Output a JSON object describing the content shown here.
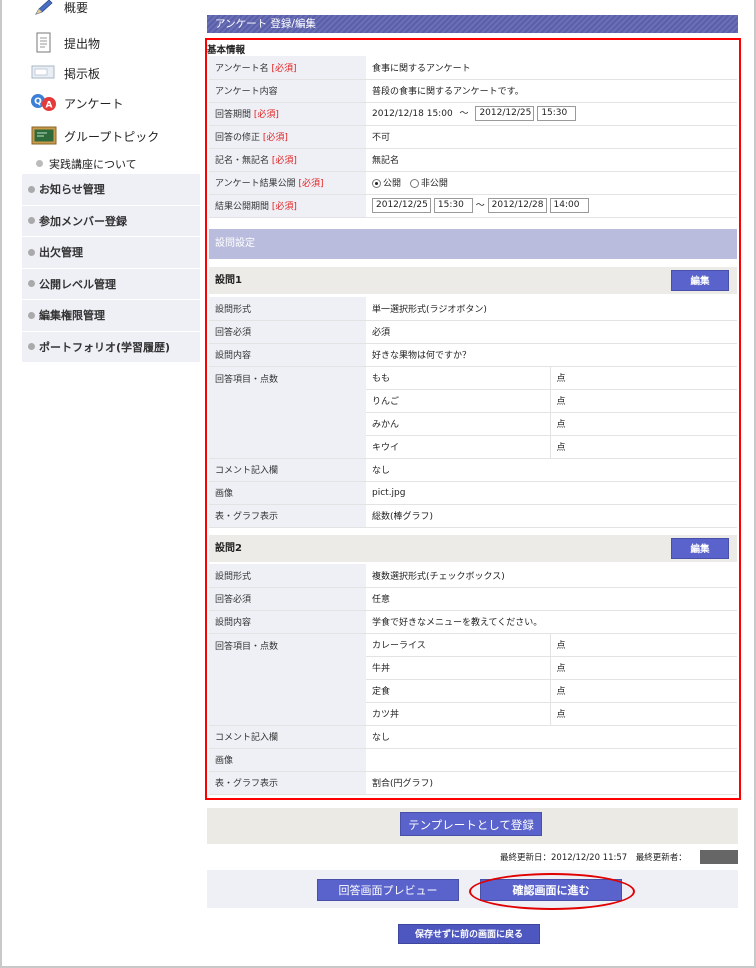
{
  "sidebar": {
    "icon_items": [
      {
        "label": "概要",
        "icon": "pencil-icon"
      },
      {
        "label": "提出物",
        "icon": "document-icon"
      },
      {
        "label": "掲示板",
        "icon": "board-icon"
      },
      {
        "label": "アンケート",
        "icon": "qa-icon"
      },
      {
        "label": "グループトピック",
        "icon": "chalkboard-icon"
      }
    ],
    "sub_item": "実践講座について",
    "menu": [
      "お知らせ管理",
      "参加メンバー登録",
      "出欠管理",
      "公開レベル管理",
      "編集権限管理",
      "ポートフォリオ(学習履歴)"
    ]
  },
  "page_title": "アンケート 登録/編集",
  "basic_info": {
    "heading": "基本情報",
    "required_mark": "[必須]",
    "rows": {
      "name_label": "アンケート名",
      "name_value": "食事に関するアンケート",
      "content_label": "アンケート内容",
      "content_value": "普段の食事に関するアンケートです。",
      "period_label": "回答期間",
      "period_start": "2012/12/18 15:00",
      "tilde": "〜",
      "period_end_date": "2012/12/25",
      "period_end_time": "15:30",
      "modify_label": "回答の修正",
      "modify_value": "不可",
      "anon_label": "記名・無記名",
      "anon_value": "無記名",
      "publish_label": "アンケート結果公開",
      "publish_on": "公開",
      "publish_off": "非公開",
      "publish_period_label": "結果公開期間",
      "pub_start_date": "2012/12/25",
      "pub_start_time": "15:30",
      "pub_end_date": "2012/12/28",
      "pub_end_time": "14:00"
    }
  },
  "question_settings_label": "設問設定",
  "edit_label": "編集",
  "labels": {
    "format": "設問形式",
    "required": "回答必須",
    "content": "設問内容",
    "items": "回答項目・点数",
    "comment": "コメント記入欄",
    "image": "画像",
    "graph": "表・グラフ表示",
    "point_unit": "点"
  },
  "questions": [
    {
      "title": "設問1",
      "format": "単一選択形式(ラジオボタン)",
      "required": "必須",
      "content": "好きな果物は何ですか？",
      "items": [
        "もも",
        "りんご",
        "みかん",
        "キウイ"
      ],
      "comment": "なし",
      "image": "pict.jpg",
      "graph": "総数(棒グラフ)"
    },
    {
      "title": "設問2",
      "format": "複数選択形式(チェックボックス)",
      "required": "任意",
      "content": "学食で好きなメニューを教えてください。",
      "items": [
        "カレーライス",
        "牛丼",
        "定食",
        "カツ丼"
      ],
      "comment": "なし",
      "image": "",
      "graph": "割合(円グラフ)"
    }
  ],
  "footer": {
    "template_button": "テンプレートとして登録",
    "last_updated": "最終更新日：2012/12/20 11:57　最終更新者：",
    "preview_button": "回答画面プレビュー",
    "confirm_button": "確認画面に進む",
    "back_button": "保存せずに前の画面に戻る"
  }
}
